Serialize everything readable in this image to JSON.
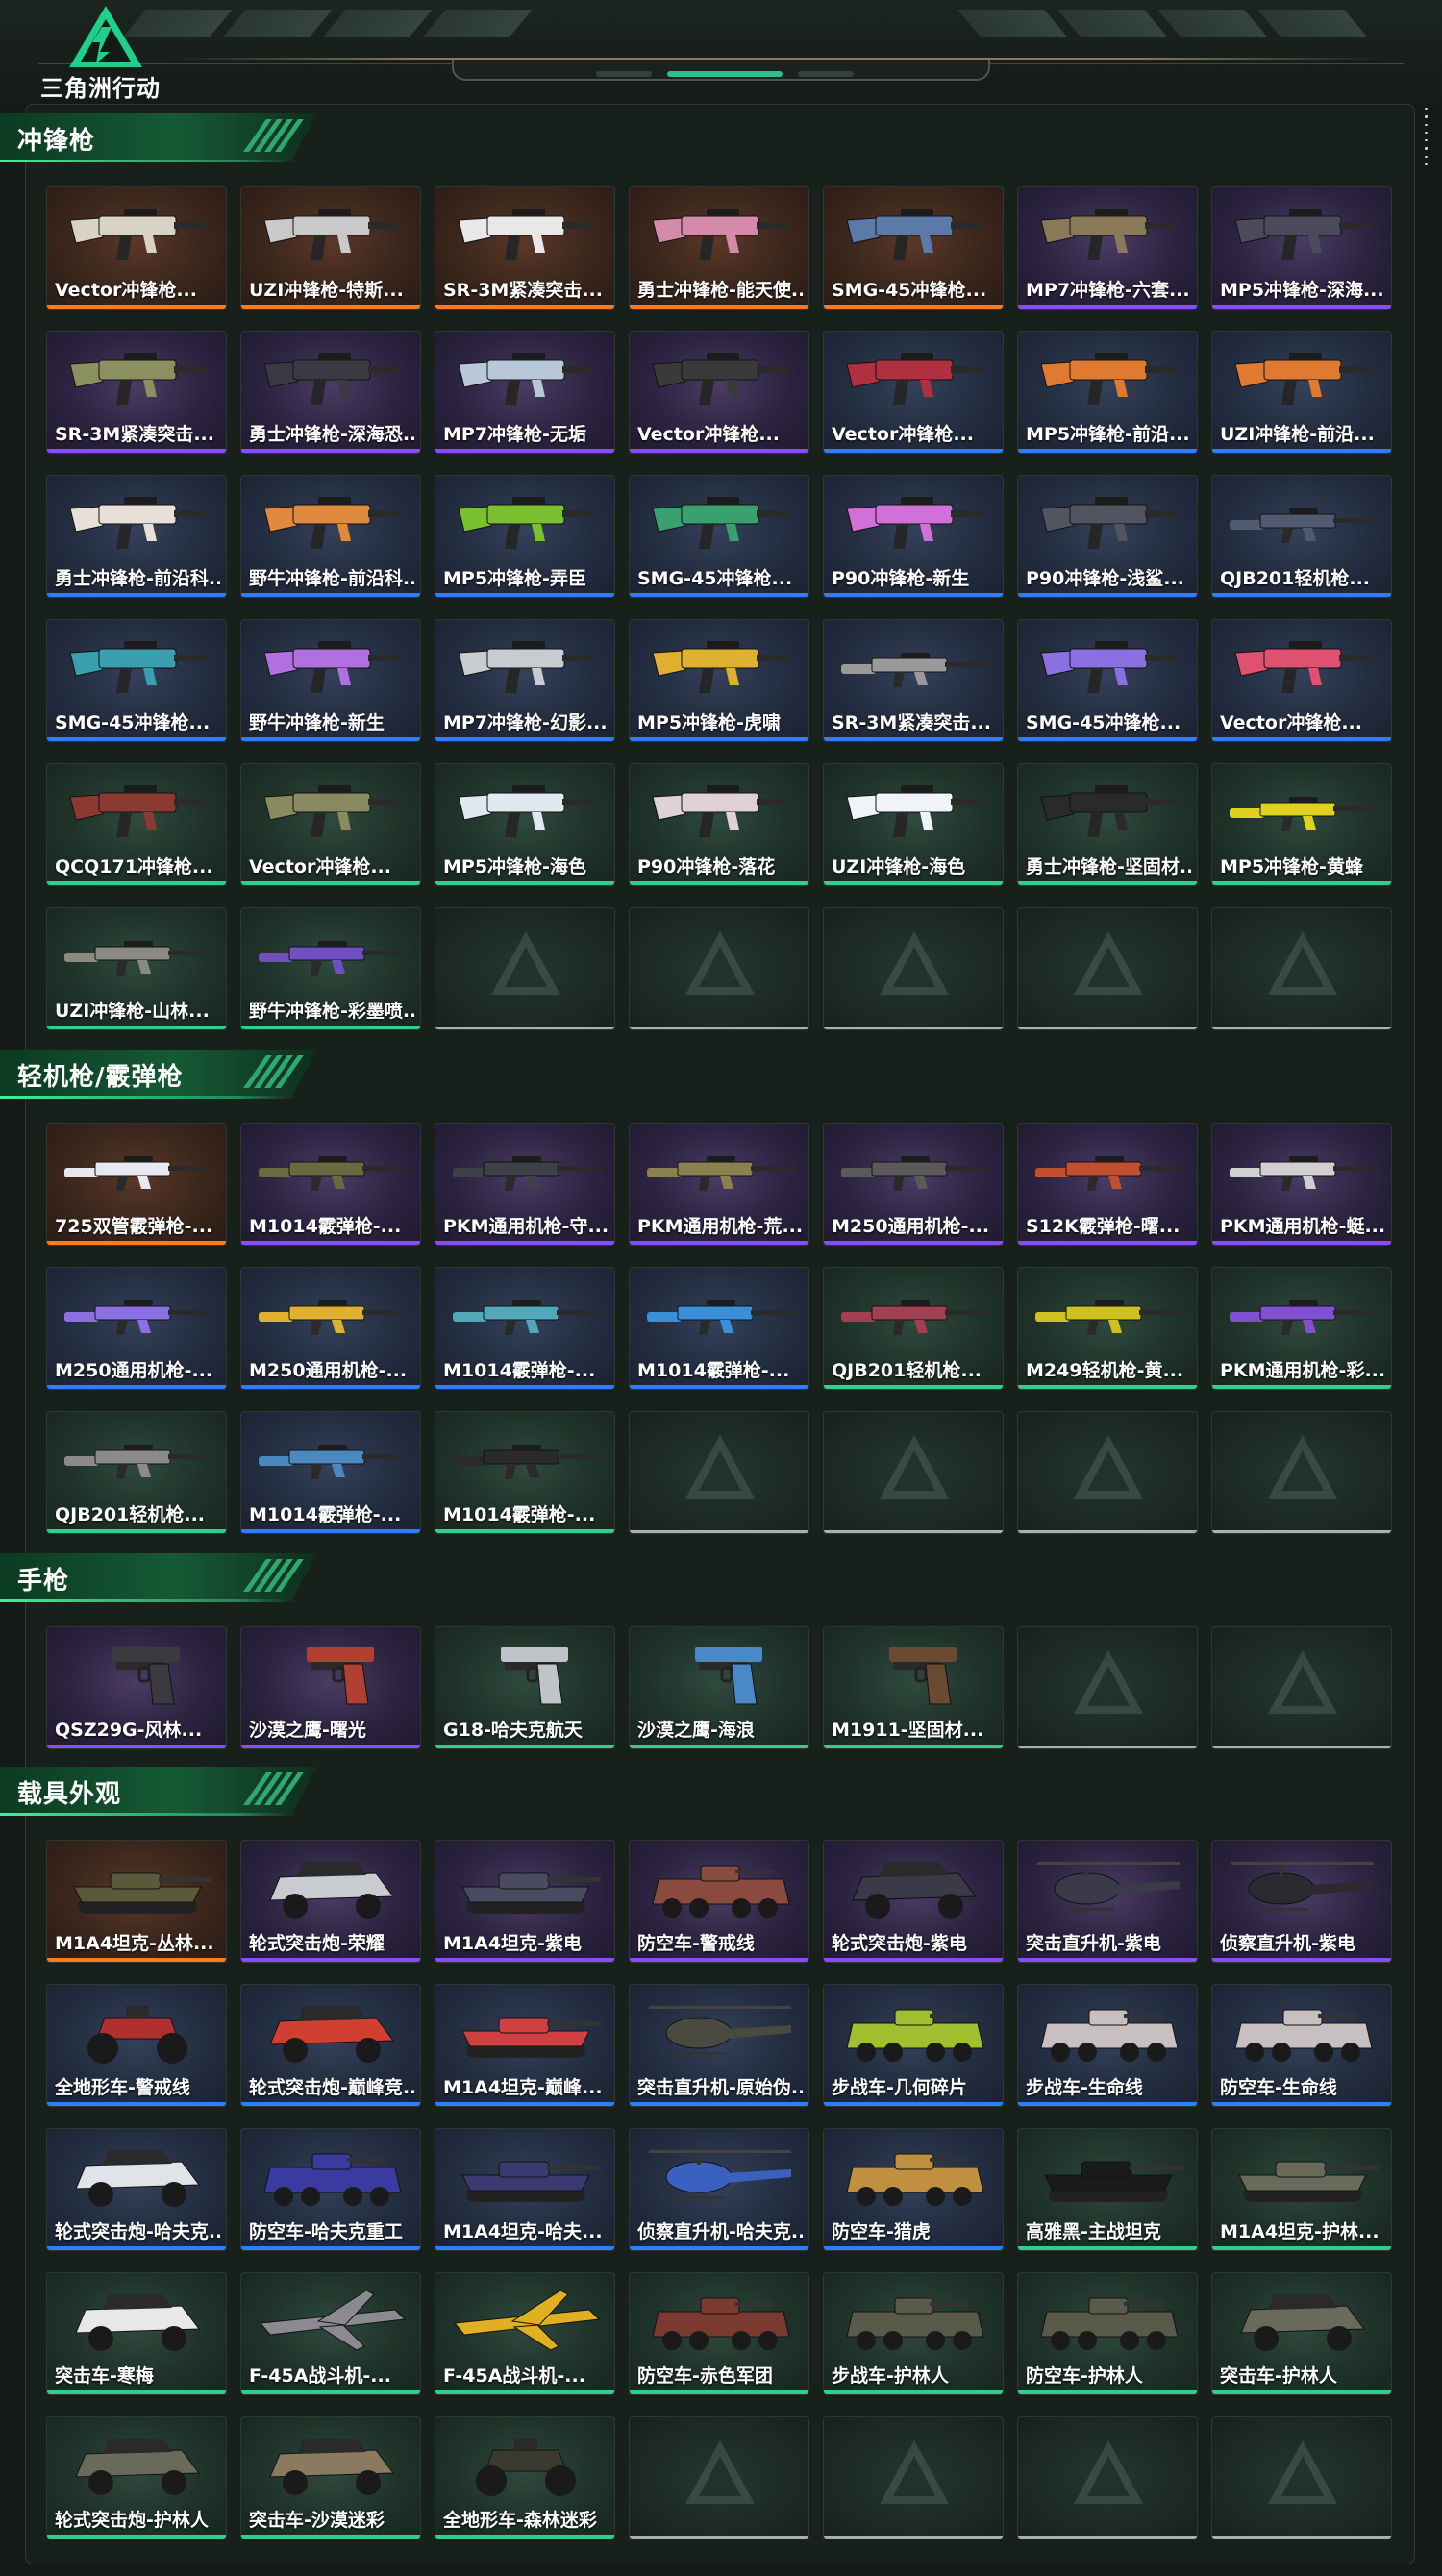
{
  "logo": {
    "text": "三角洲行动"
  },
  "colors": {
    "purple": "#8a4bff",
    "orange": "#ff7a1a",
    "blue": "#2d7dff",
    "green": "#2fd08f",
    "accent": "#2fc08a"
  },
  "sections": [
    {
      "title": "冲锋枪",
      "items": [
        {
          "label": "Vector冲锋枪...",
          "rarity": "orange",
          "kind": "smg",
          "color": "#d9d3c6"
        },
        {
          "label": "UZI冲锋枪-特斯...",
          "rarity": "orange",
          "kind": "smg",
          "color": "#c9c9c9"
        },
        {
          "label": "SR-3M紧凑突击...",
          "rarity": "orange",
          "kind": "smg",
          "color": "#e8e8e8"
        },
        {
          "label": "勇士冲锋枪-能天使...",
          "rarity": "orange",
          "kind": "smg",
          "color": "#d48aa8"
        },
        {
          "label": "SMG-45冲锋枪...",
          "rarity": "orange",
          "kind": "smg",
          "color": "#5b7aa8"
        },
        {
          "label": "MP7冲锋枪-六套...",
          "rarity": "purple",
          "kind": "smg",
          "color": "#8a7a5a"
        },
        {
          "label": "MP5冲锋枪-深海...",
          "rarity": "purple",
          "kind": "smg",
          "color": "#4a4a5a"
        },
        {
          "label": "SR-3M紧凑突击...",
          "rarity": "purple",
          "kind": "smg",
          "color": "#8a9060"
        },
        {
          "label": "勇士冲锋枪-深海恐...",
          "rarity": "purple",
          "kind": "smg",
          "color": "#3a3a45"
        },
        {
          "label": "MP7冲锋枪-无垢",
          "rarity": "purple",
          "kind": "smg",
          "color": "#b8c8d8"
        },
        {
          "label": "Vector冲锋枪...",
          "rarity": "purple",
          "kind": "smg",
          "color": "#3a3a3a"
        },
        {
          "label": "Vector冲锋枪...",
          "rarity": "blue",
          "kind": "smg",
          "color": "#b03040"
        },
        {
          "label": "MP5冲锋枪-前沿...",
          "rarity": "blue",
          "kind": "smg",
          "color": "#e07a30"
        },
        {
          "label": "UZI冲锋枪-前沿...",
          "rarity": "blue",
          "kind": "smg",
          "color": "#e07a30"
        },
        {
          "label": "勇士冲锋枪-前沿科...",
          "rarity": "blue",
          "kind": "smg",
          "color": "#e8e0d8"
        },
        {
          "label": "野牛冲锋枪-前沿科...",
          "rarity": "blue",
          "kind": "smg",
          "color": "#e08a40"
        },
        {
          "label": "MP5冲锋枪-弄臣",
          "rarity": "blue",
          "kind": "smg",
          "color": "#7ac030"
        },
        {
          "label": "SMG-45冲锋枪...",
          "rarity": "blue",
          "kind": "smg",
          "color": "#3aa070"
        },
        {
          "label": "P90冲锋枪-新生",
          "rarity": "blue",
          "kind": "smg",
          "color": "#d070d8"
        },
        {
          "label": "P90冲锋枪-浅鲨...",
          "rarity": "blue",
          "kind": "smg",
          "color": "#505560"
        },
        {
          "label": "QJB201轻机枪...",
          "rarity": "blue",
          "kind": "rifle",
          "color": "#505a70"
        },
        {
          "label": "SMG-45冲锋枪...",
          "rarity": "blue",
          "kind": "smg",
          "color": "#3aa0b0"
        },
        {
          "label": "野牛冲锋枪-新生",
          "rarity": "blue",
          "kind": "smg",
          "color": "#b070e0"
        },
        {
          "label": "MP7冲锋枪-幻影...",
          "rarity": "blue",
          "kind": "smg",
          "color": "#c8ccd0"
        },
        {
          "label": "MP5冲锋枪-虎啸",
          "rarity": "blue",
          "kind": "smg",
          "color": "#e0b030"
        },
        {
          "label": "SR-3M紧凑突击...",
          "rarity": "blue",
          "kind": "rifle",
          "color": "#9a9a9a"
        },
        {
          "label": "SMG-45冲锋枪...",
          "rarity": "blue",
          "kind": "smg",
          "color": "#8a70e0"
        },
        {
          "label": "Vector冲锋枪...",
          "rarity": "blue",
          "kind": "smg",
          "color": "#e05070"
        },
        {
          "label": "QCQ171冲锋枪...",
          "rarity": "green",
          "kind": "smg",
          "color": "#8a3a30"
        },
        {
          "label": "Vector冲锋枪...",
          "rarity": "green",
          "kind": "smg",
          "color": "#8a8a60"
        },
        {
          "label": "MP5冲锋枪-海色",
          "rarity": "green",
          "kind": "smg",
          "color": "#e0e8f0"
        },
        {
          "label": "P90冲锋枪-落花",
          "rarity": "green",
          "kind": "smg",
          "color": "#e0d0d8"
        },
        {
          "label": "UZI冲锋枪-海色",
          "rarity": "green",
          "kind": "smg",
          "color": "#f0f4f8"
        },
        {
          "label": "勇士冲锋枪-坚固材...",
          "rarity": "green",
          "kind": "smg",
          "color": "#2a2a2a"
        },
        {
          "label": "MP5冲锋枪-黄蜂",
          "rarity": "green",
          "kind": "rifle",
          "color": "#e0d020"
        },
        {
          "label": "UZI冲锋枪-山林...",
          "rarity": "green",
          "kind": "rifle",
          "color": "#8a8a80"
        },
        {
          "label": "野牛冲锋枪-彩墨喷...",
          "rarity": "green",
          "kind": "rifle",
          "color": "#7050c0"
        },
        {
          "label": "",
          "rarity": "empty"
        },
        {
          "label": "",
          "rarity": "empty"
        },
        {
          "label": "",
          "rarity": "empty"
        },
        {
          "label": "",
          "rarity": "empty"
        },
        {
          "label": "",
          "rarity": "empty"
        }
      ]
    },
    {
      "title": "轻机枪/霰弹枪",
      "items": [
        {
          "label": "725双管霰弹枪-...",
          "rarity": "orange",
          "kind": "rifle",
          "color": "#e8e8f0"
        },
        {
          "label": "M1014霰弹枪-...",
          "rarity": "purple",
          "kind": "rifle",
          "color": "#6a6a40"
        },
        {
          "label": "PKM通用机枪-守...",
          "rarity": "purple",
          "kind": "rifle",
          "color": "#404048"
        },
        {
          "label": "PKM通用机枪-荒...",
          "rarity": "purple",
          "kind": "rifle",
          "color": "#8a8050"
        },
        {
          "label": "M250通用机枪-...",
          "rarity": "purple",
          "kind": "rifle",
          "color": "#5a5a5a"
        },
        {
          "label": "S12K霰弹枪-曙...",
          "rarity": "purple",
          "kind": "rifle",
          "color": "#c05030"
        },
        {
          "label": "PKM通用机枪-蜓...",
          "rarity": "purple",
          "kind": "rifle",
          "color": "#d0d0d0"
        },
        {
          "label": "M250通用机枪-...",
          "rarity": "blue",
          "kind": "rifle",
          "color": "#8a70e0"
        },
        {
          "label": "M250通用机枪-...",
          "rarity": "blue",
          "kind": "rifle",
          "color": "#e0b030"
        },
        {
          "label": "M1014霰弹枪-...",
          "rarity": "blue",
          "kind": "rifle",
          "color": "#50a8b8"
        },
        {
          "label": "M1014霰弹枪-...",
          "rarity": "blue",
          "kind": "rifle",
          "color": "#3a90d8"
        },
        {
          "label": "QJB201轻机枪...",
          "rarity": "green",
          "kind": "rifle",
          "color": "#a04050"
        },
        {
          "label": "M249轻机枪-黄...",
          "rarity": "green",
          "kind": "rifle",
          "color": "#d0c020"
        },
        {
          "label": "PKM通用机枪-彩...",
          "rarity": "green",
          "kind": "rifle",
          "color": "#8050d0"
        },
        {
          "label": "QJB201轻机枪...",
          "rarity": "green",
          "kind": "rifle",
          "color": "#8a8a8a"
        },
        {
          "label": "M1014霰弹枪-...",
          "rarity": "blue",
          "kind": "rifle",
          "color": "#4a88c0"
        },
        {
          "label": "M1014霰弹枪-...",
          "rarity": "green",
          "kind": "rifle",
          "color": "#2a2a2a"
        },
        {
          "label": "",
          "rarity": "empty"
        },
        {
          "label": "",
          "rarity": "empty"
        },
        {
          "label": "",
          "rarity": "empty"
        },
        {
          "label": "",
          "rarity": "empty"
        }
      ]
    },
    {
      "title": "手枪",
      "items": [
        {
          "label": "QSZ29G-风林...",
          "rarity": "purple",
          "kind": "pistol",
          "color": "#3a3a40"
        },
        {
          "label": "沙漠之鹰-曙光",
          "rarity": "purple",
          "kind": "pistol",
          "color": "#b04030"
        },
        {
          "label": "G18-哈夫克航天",
          "rarity": "green",
          "kind": "pistol",
          "color": "#c0c4c8"
        },
        {
          "label": "沙漠之鹰-海浪",
          "rarity": "green",
          "kind": "pistol",
          "color": "#4a88c8"
        },
        {
          "label": "M1911-坚固材...",
          "rarity": "green",
          "kind": "pistol",
          "color": "#6a4a30"
        },
        {
          "label": "",
          "rarity": "empty"
        },
        {
          "label": "",
          "rarity": "empty"
        }
      ]
    },
    {
      "title": "载具外观",
      "items": [
        {
          "label": "M1A4坦克-丛林...",
          "rarity": "orange",
          "kind": "tank",
          "color": "#5a5a3a"
        },
        {
          "label": "轮式突击炮-荣耀",
          "rarity": "purple",
          "kind": "buggy",
          "color": "#c8ccd0"
        },
        {
          "label": "M1A4坦克-紫电",
          "rarity": "purple",
          "kind": "tank",
          "color": "#4a4a60"
        },
        {
          "label": "防空车-警戒线",
          "rarity": "purple",
          "kind": "apc",
          "color": "#8a4a40"
        },
        {
          "label": "轮式突击炮-紫电",
          "rarity": "purple",
          "kind": "buggy",
          "color": "#3a3a48"
        },
        {
          "label": "突击直升机-紫电",
          "rarity": "purple",
          "kind": "heli",
          "color": "#3a3a48"
        },
        {
          "label": "侦察直升机-紫电",
          "rarity": "purple",
          "kind": "heli",
          "color": "#2a2a30"
        },
        {
          "label": "全地形车-警戒线",
          "rarity": "blue",
          "kind": "atv",
          "color": "#b03030"
        },
        {
          "label": "轮式突击炮-巅峰竞...",
          "rarity": "blue",
          "kind": "buggy",
          "color": "#d04030"
        },
        {
          "label": "M1A4坦克-巅峰...",
          "rarity": "blue",
          "kind": "tank",
          "color": "#d04040"
        },
        {
          "label": "突击直升机-原始伪...",
          "rarity": "blue",
          "kind": "heli",
          "color": "#4a4a40"
        },
        {
          "label": "步战车-几何碎片",
          "rarity": "blue",
          "kind": "apc",
          "color": "#a0c030"
        },
        {
          "label": "步战车-生命线",
          "rarity": "blue",
          "kind": "apc",
          "color": "#c8c0c0"
        },
        {
          "label": "防空车-生命线",
          "rarity": "blue",
          "kind": "apc",
          "color": "#c8c0c0"
        },
        {
          "label": "轮式突击炮-哈夫克...",
          "rarity": "blue",
          "kind": "buggy",
          "color": "#e0e4e8"
        },
        {
          "label": "防空车-哈夫克重工",
          "rarity": "blue",
          "kind": "apc",
          "color": "#3a3aa0"
        },
        {
          "label": "M1A4坦克-哈夫...",
          "rarity": "blue",
          "kind": "tank",
          "color": "#3a3a70"
        },
        {
          "label": "侦察直升机-哈夫克...",
          "rarity": "blue",
          "kind": "heli",
          "color": "#3a60c0"
        },
        {
          "label": "防空车-猎虎",
          "rarity": "blue",
          "kind": "apc",
          "color": "#c09040"
        },
        {
          "label": "高雅黑-主战坦克",
          "rarity": "green",
          "kind": "tank",
          "color": "#1a1a1a"
        },
        {
          "label": "M1A4坦克-护林...",
          "rarity": "green",
          "kind": "tank",
          "color": "#6a6a5a"
        },
        {
          "label": "突击车-寒梅",
          "rarity": "green",
          "kind": "buggy",
          "color": "#e8e8e8"
        },
        {
          "label": "F-45A战斗机-...",
          "rarity": "green",
          "kind": "jet",
          "color": "#8a8a90"
        },
        {
          "label": "F-45A战斗机-...",
          "rarity": "green",
          "kind": "jet",
          "color": "#e0b020"
        },
        {
          "label": "防空车-赤色军团",
          "rarity": "green",
          "kind": "apc",
          "color": "#7a3a30"
        },
        {
          "label": "步战车-护林人",
          "rarity": "green",
          "kind": "apc",
          "color": "#5a5a4a"
        },
        {
          "label": "防空车-护林人",
          "rarity": "green",
          "kind": "apc",
          "color": "#5a5a4a"
        },
        {
          "label": "突击车-护林人",
          "rarity": "green",
          "kind": "buggy",
          "color": "#6a6a5a"
        },
        {
          "label": "轮式突击炮-护林人",
          "rarity": "green",
          "kind": "buggy",
          "color": "#6a6a5a"
        },
        {
          "label": "突击车-沙漠迷彩",
          "rarity": "green",
          "kind": "buggy",
          "color": "#8a7a60"
        },
        {
          "label": "全地形车-森林迷彩",
          "rarity": "green",
          "kind": "atv",
          "color": "#3a3a30"
        },
        {
          "label": "",
          "rarity": "empty"
        },
        {
          "label": "",
          "rarity": "empty"
        },
        {
          "label": "",
          "rarity": "empty"
        },
        {
          "label": "",
          "rarity": "empty"
        }
      ]
    }
  ]
}
